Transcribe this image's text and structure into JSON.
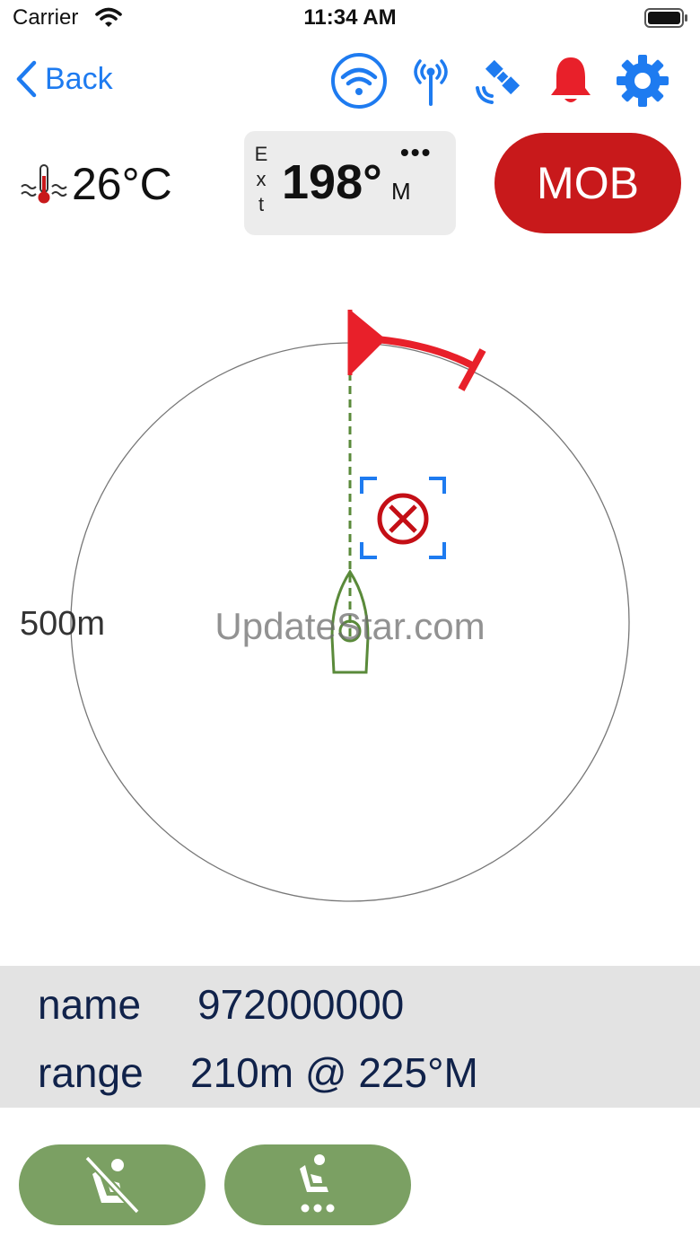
{
  "status_bar": {
    "carrier": "Carrier",
    "time": "11:34 AM",
    "wifi_icon": "wifi-icon",
    "battery_icon": "battery-icon"
  },
  "nav": {
    "back_label": "Back",
    "icons": [
      "wifi-circle-icon",
      "antenna-icon",
      "satellite-icon",
      "bell-icon",
      "gear-icon"
    ],
    "accent_color": "#1e7bf0",
    "alarm_color": "#e8202a"
  },
  "info_row": {
    "temperature": "26°C",
    "thermometer_icon": "water-thermometer-icon",
    "heading_source": [
      "E",
      "x",
      "t"
    ],
    "heading_value": "198°",
    "heading_unit": "M",
    "heading_menu": "•••",
    "mob_label": "MOB",
    "mob_color": "#c8191b"
  },
  "radar": {
    "range_label": "500m",
    "watermark": "UpdateStar.com",
    "target_icon": "target-x-icon",
    "boat_icon": "boat-icon",
    "heading_flag_icon": "heading-flag-icon",
    "target_color": "#c40f16",
    "boat_color": "#5a8a3a"
  },
  "target_info": {
    "name_label": "name",
    "name_value": "972000000",
    "range_label": "range",
    "range_value": "210m @ 225°M"
  },
  "bottom": {
    "left_button_icon": "seat-disabled-icon",
    "right_button_icon": "seat-more-icon",
    "button_color": "#7ba063"
  }
}
